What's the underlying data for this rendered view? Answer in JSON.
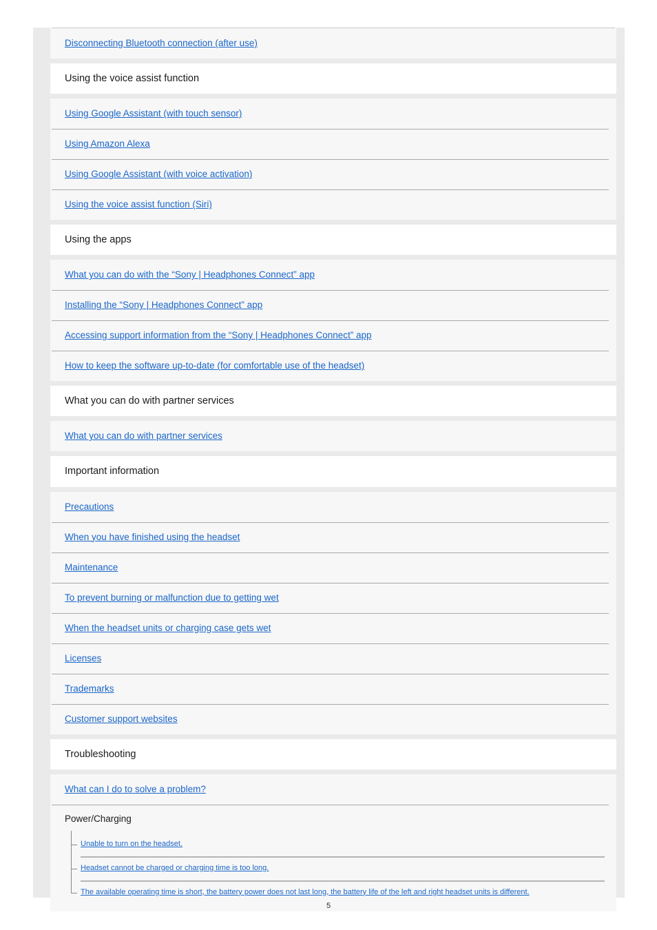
{
  "document": {
    "page_number": "5",
    "link_color": "#1a66c9",
    "text_color": "#1a1a1a",
    "page_background": "#eaeaea",
    "row_background": "#f7f7f7",
    "header_background": "#ffffff"
  },
  "toc": {
    "blocks": [
      {
        "kind": "links",
        "items": [
          {
            "label": "Disconnecting Bluetooth connection (after use)"
          }
        ]
      },
      {
        "kind": "section",
        "title": "Using the voice assist function"
      },
      {
        "kind": "links",
        "items": [
          {
            "label": "Using Google Assistant (with touch sensor)"
          },
          {
            "label": "Using Amazon Alexa"
          },
          {
            "label": "Using Google Assistant (with voice activation)"
          },
          {
            "label": "Using the voice assist function (Siri)"
          }
        ]
      },
      {
        "kind": "section",
        "title": "Using the apps"
      },
      {
        "kind": "links",
        "items": [
          {
            "label": "What you can do with the “Sony | Headphones Connect” app"
          },
          {
            "label": "Installing the “Sony | Headphones Connect” app"
          },
          {
            "label": "Accessing support information from the “Sony | Headphones Connect” app"
          },
          {
            "label": "How to keep the software up-to-date (for comfortable use of the headset)"
          }
        ]
      },
      {
        "kind": "section",
        "title": "What you can do with partner services"
      },
      {
        "kind": "links",
        "items": [
          {
            "label": "What you can do with partner services"
          }
        ]
      },
      {
        "kind": "section",
        "title": "Important information"
      },
      {
        "kind": "links",
        "items": [
          {
            "label": "Precautions"
          },
          {
            "label": "When you have finished using the headset"
          },
          {
            "label": "Maintenance"
          },
          {
            "label": "To prevent burning or malfunction due to getting wet"
          },
          {
            "label": "When the headset units or charging case gets wet"
          },
          {
            "label": "Licenses"
          },
          {
            "label": "Trademarks"
          },
          {
            "label": "Customer support websites"
          }
        ]
      },
      {
        "kind": "section",
        "title": "Troubleshooting"
      },
      {
        "kind": "links",
        "items": [
          {
            "label": "What can I do to solve a problem?"
          }
        ],
        "subgroup": {
          "title": "Power/Charging",
          "items": [
            {
              "label": "Unable to turn on the headset."
            },
            {
              "label": "Headset cannot be charged or charging time is too long."
            },
            {
              "label": "The available operating time is short, the battery power does not last long, the battery life of the left and right headset units is different."
            }
          ]
        }
      }
    ]
  }
}
